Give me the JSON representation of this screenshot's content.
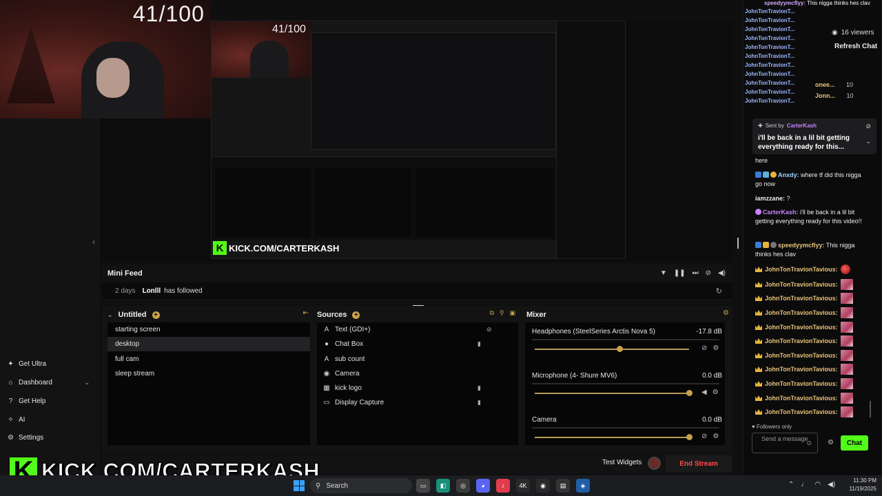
{
  "overlay": {
    "counter": "41/100",
    "counter_nested": "41/100",
    "kick_url": "KICK.COM/CARTERKASH",
    "kick_letter": "K"
  },
  "nav": {
    "items": [
      {
        "label": "Get Ultra",
        "icon": "sparkle-icon"
      },
      {
        "label": "Dashboard",
        "icon": "dashboard-icon"
      },
      {
        "label": "Get Help",
        "icon": "help-icon"
      },
      {
        "label": "AI",
        "icon": "ai-icon"
      },
      {
        "label": "Settings",
        "icon": "gear-icon"
      }
    ]
  },
  "minifeed": {
    "title": "Mini Feed",
    "event": {
      "days": "2 days",
      "user": "Lonlll",
      "action": "has followed"
    }
  },
  "scenes": {
    "title": "Untitled",
    "items": [
      "starting screen",
      "desktop",
      "full cam",
      "sleep stream"
    ],
    "selected": 1
  },
  "sources": {
    "title": "Sources",
    "items": [
      {
        "label": "Text (GDI+)",
        "icon": "text-icon"
      },
      {
        "label": "Chat Box",
        "icon": "chat-icon"
      },
      {
        "label": "sub count",
        "icon": "text-icon"
      },
      {
        "label": "Camera",
        "icon": "camera-icon"
      },
      {
        "label": "kick logo",
        "icon": "image-icon"
      },
      {
        "label": "Display Capture",
        "icon": "monitor-icon"
      }
    ]
  },
  "mixer": {
    "title": "Mixer",
    "channels": [
      {
        "name": "Headphones (SteelSeries Arctis Nova 5)",
        "db": "-17.8 dB",
        "level": 0.55
      },
      {
        "name": "Microphone (4- Shure MV6)",
        "db": "0.0 dB",
        "level": 1.0
      },
      {
        "name": "Camera",
        "db": "0.0 dB",
        "level": 1.0
      }
    ]
  },
  "footer": {
    "test_widgets": "Test Widgets",
    "end_stream": "End Stream"
  },
  "chat": {
    "top_line_user": "speedyymcflyy:",
    "top_line_text": "This nigga thinks hes clav",
    "viewers": "16 viewers",
    "refresh": "Refresh Chat",
    "spam_user": "JohnTonTravionT...",
    "top_msgs": [
      {
        "user": "onee...",
        "count": "10"
      },
      {
        "user": "Jonn...",
        "count": "10"
      }
    ],
    "pinned": {
      "sent_by": "Sent by",
      "author": "CarterKash",
      "text": "i'll be back in a lil bit getting everything ready for this..."
    },
    "messages": [
      {
        "user": "",
        "text": "here"
      },
      {
        "user": "Anxdy:",
        "text": "where tf did this nigga go now",
        "color": "#9fd0ff"
      },
      {
        "user": "iamzzane:",
        "text": "?",
        "color": "#e0e0e0"
      },
      {
        "user": "CarterKash:",
        "text": "i'll be back in a lil bit getting everything ready for this video!!",
        "color": "#c781ff"
      },
      {
        "user": "speedyymcflyy:",
        "text": "This nigga thinks hes clav",
        "color": "#e8c27a"
      }
    ],
    "jt_user": "JohnTonTravionTavious:",
    "followers_only": "Followers only",
    "input_placeholder": "Send a message",
    "send_label": "Chat"
  },
  "taskbar": {
    "search": "Search",
    "time": "11:30 PM",
    "date": "11/19/2025"
  },
  "colors": {
    "kick_green": "#53fc18",
    "accent_gold": "#c9a24b",
    "end_red": "#ff4d4d"
  }
}
